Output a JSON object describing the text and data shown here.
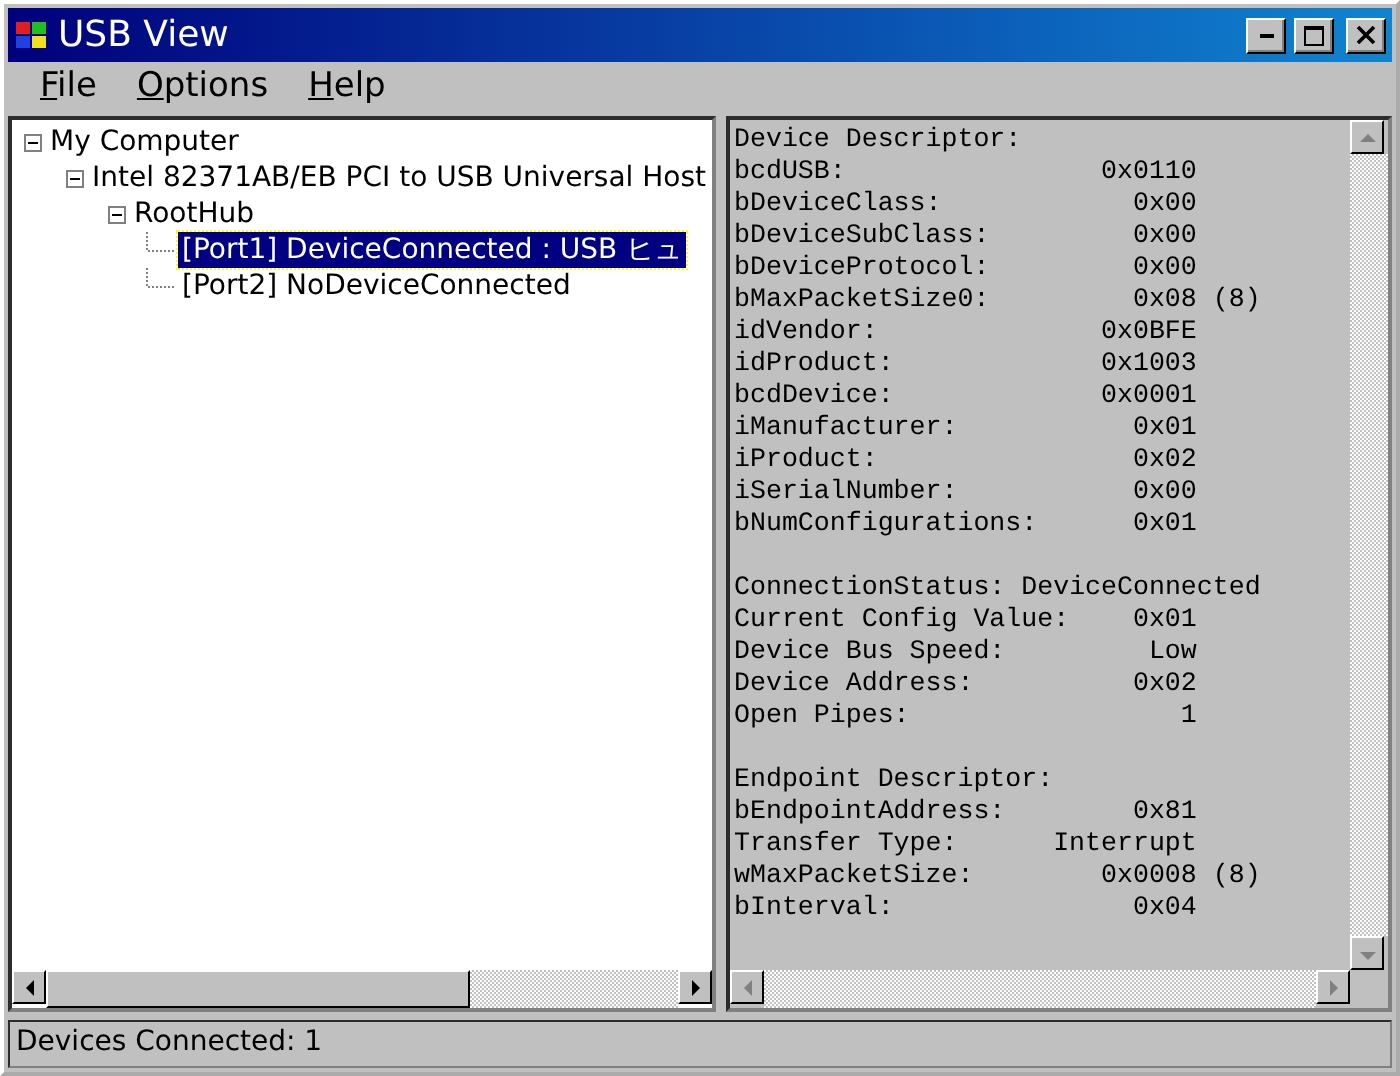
{
  "window": {
    "title": "USB View"
  },
  "menu": [
    {
      "label": "File"
    },
    {
      "label": "Options"
    },
    {
      "label": "Help"
    }
  ],
  "tree": [
    {
      "label": "My Computer",
      "expanded": true,
      "selected": false,
      "children": [
        {
          "label": "Intel 82371AB/EB PCI to USB Universal Host",
          "expanded": true,
          "selected": false,
          "children": [
            {
              "label": "RootHub",
              "expanded": true,
              "selected": false,
              "children": [
                {
                  "label": "[Port1] DeviceConnected : USB ヒュ",
                  "selected": true
                },
                {
                  "label": "[Port2] NoDeviceConnected",
                  "selected": false
                }
              ]
            }
          ]
        }
      ]
    }
  ],
  "details": [
    [
      {
        "label": "Device Descriptor:"
      },
      {
        "label": "bcdUSB:",
        "value": "0x0110"
      },
      {
        "label": "bDeviceClass:",
        "value": "0x00"
      },
      {
        "label": "bDeviceSubClass:",
        "value": "0x00"
      },
      {
        "label": "bDeviceProtocol:",
        "value": "0x00"
      },
      {
        "label": "bMaxPacketSize0:",
        "value": "0x08",
        "note": "(8)"
      },
      {
        "label": "idVendor:",
        "value": "0x0BFE"
      },
      {
        "label": "idProduct:",
        "value": "0x1003"
      },
      {
        "label": "bcdDevice:",
        "value": "0x0001"
      },
      {
        "label": "iManufacturer:",
        "value": "0x01"
      },
      {
        "label": "iProduct:",
        "value": "0x02"
      },
      {
        "label": "iSerialNumber:",
        "value": "0x00"
      },
      {
        "label": "bNumConfigurations:",
        "value": "0x01"
      }
    ],
    [
      {
        "label": "ConnectionStatus:",
        "value": "DeviceConnected"
      },
      {
        "label": "Current Config Value:",
        "value": "0x01"
      },
      {
        "label": "Device Bus Speed:",
        "value": "Low"
      },
      {
        "label": "Device Address:",
        "value": "0x02"
      },
      {
        "label": "Open Pipes:",
        "value": "1"
      }
    ],
    [
      {
        "label": "Endpoint Descriptor:"
      },
      {
        "label": "bEndpointAddress:",
        "value": "0x81"
      },
      {
        "label": "Transfer Type:",
        "value": "Interrupt"
      },
      {
        "label": "wMaxPacketSize:",
        "value": "0x0008",
        "note": "(8)"
      },
      {
        "label": "bInterval:",
        "value": "0x04"
      }
    ]
  ],
  "status_bar": "Devices Connected: 1"
}
